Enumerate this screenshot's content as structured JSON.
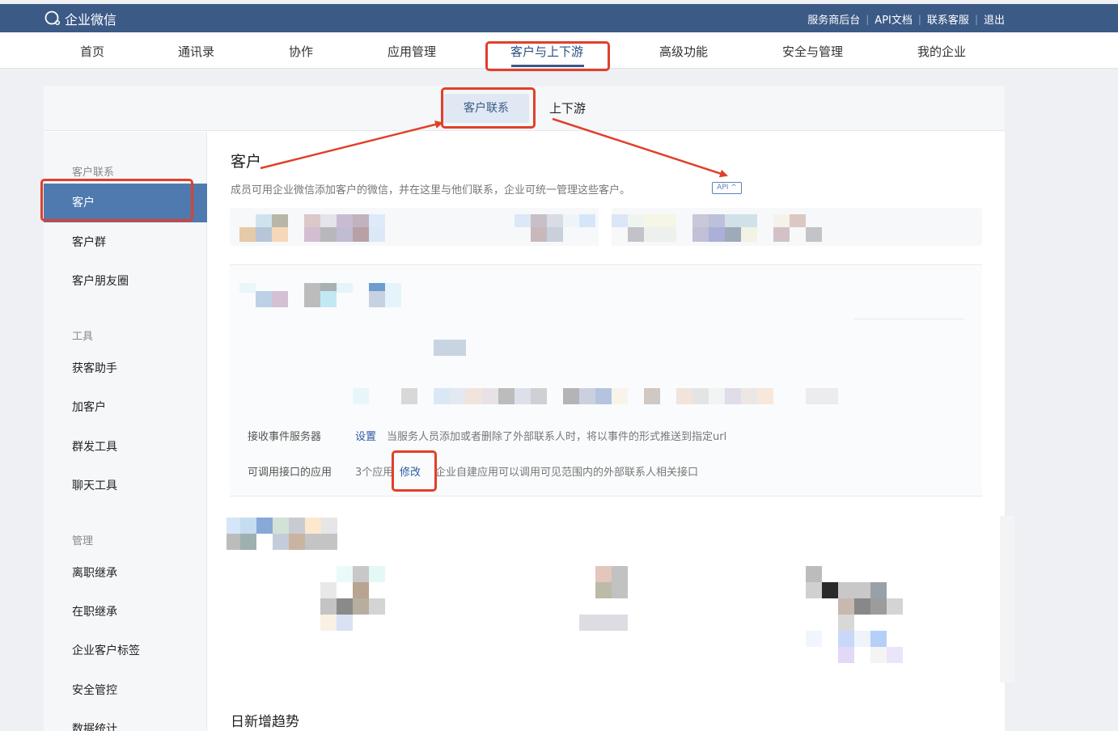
{
  "topbar": {
    "logo_text": "企业微信",
    "links": [
      "服务商后台",
      "API文档",
      "联系客服",
      "退出"
    ]
  },
  "nav": {
    "items": [
      "首页",
      "通讯录",
      "协作",
      "应用管理",
      "客户与上下游",
      "高级功能",
      "安全与管理",
      "我的企业"
    ],
    "active_index": 4
  },
  "subtabs": {
    "items": [
      "客户联系",
      "上下游"
    ],
    "active_index": 0
  },
  "sidebar": {
    "groups": [
      {
        "label": "客户联系",
        "items": [
          "客户",
          "客户群",
          "客户朋友圈"
        ]
      },
      {
        "label": "工具",
        "items": [
          "获客助手",
          "加客户",
          "群发工具",
          "聊天工具"
        ]
      },
      {
        "label": "管理",
        "items": [
          "离职继承",
          "在职继承",
          "企业客户标签",
          "安全管控",
          "数据统计"
        ]
      }
    ],
    "active_item": "客户"
  },
  "content": {
    "title": "客户",
    "description": "成员可用企业微信添加客户的微信，并在这里与他们联系，企业可统一管理这些客户。",
    "api_badge": "API ^",
    "rows": [
      {
        "label": "接收事件服务器",
        "link": "设置",
        "text": "当服务人员添加或者删除了外部联系人时，将以事件的形式推送到指定url"
      },
      {
        "label": "可调用接口的应用",
        "value": "3个应用",
        "link": "修改",
        "text": "企业自建应用可以调用可见范围内的外部联系人相关接口"
      }
    ],
    "section_title": "日新增趋势"
  },
  "colors": {
    "topbar": "#3b5a86",
    "sidebar_active": "#4f7ab0",
    "annotation": "#e0402a",
    "link": "#2b5aa0"
  }
}
